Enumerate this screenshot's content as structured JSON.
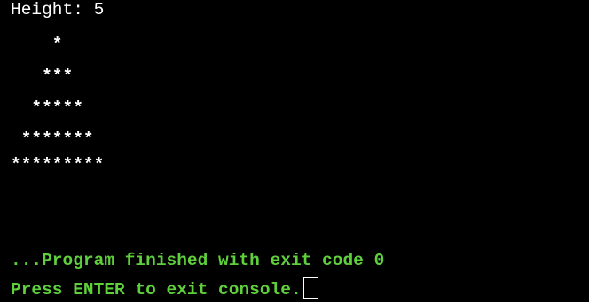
{
  "console": {
    "prompt_line": "Height: 5",
    "pyramid_rows": [
      "    *",
      "   ***",
      "  *****",
      " *******",
      "*********"
    ],
    "finished_line": "...Program finished with exit code 0",
    "exit_prompt": "Press ENTER to exit console."
  },
  "colors": {
    "background": "#000000",
    "output_text": "#ffffff",
    "status_text": "#5fd03b"
  }
}
